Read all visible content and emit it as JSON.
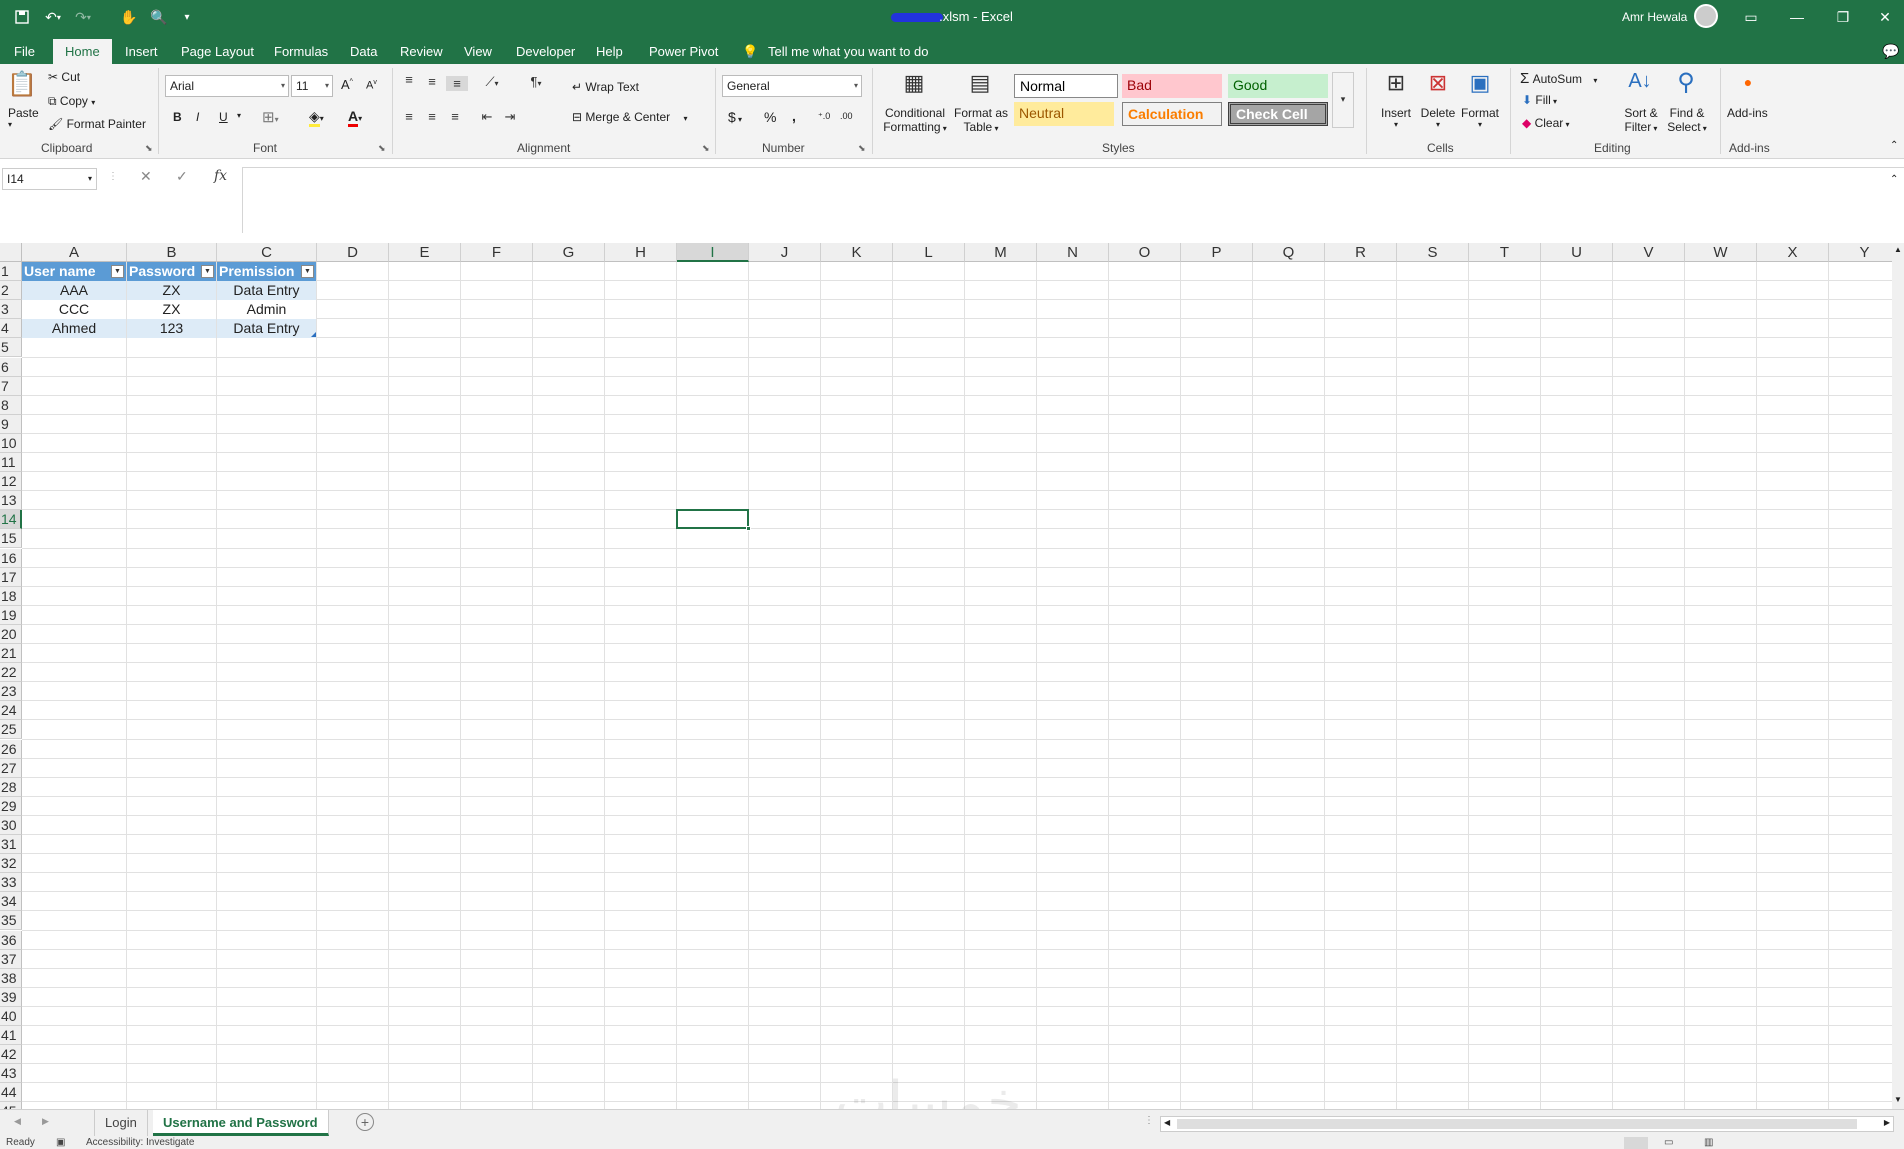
{
  "titlebar": {
    "file_suffix": ".xlsm",
    "separator": " - ",
    "app_name": "Excel",
    "user_name": "Amr Hewala"
  },
  "ribbon_tabs": [
    "File",
    "Home",
    "Insert",
    "Page Layout",
    "Formulas",
    "Data",
    "Review",
    "View",
    "Developer",
    "Help",
    "Power Pivot"
  ],
  "search": {
    "placeholder": "Tell me what you want to do"
  },
  "clipboard": {
    "paste": "Paste",
    "cut": "Cut",
    "copy": "Copy",
    "format_painter": "Format Painter",
    "label": "Clipboard"
  },
  "font": {
    "name": "Arial",
    "size": "11",
    "bold": "B",
    "italic": "I",
    "underline": "U",
    "label": "Font"
  },
  "alignment": {
    "wrap_text": "Wrap Text",
    "merge_center": "Merge & Center",
    "label": "Alignment"
  },
  "number": {
    "format": "General",
    "currency": "$",
    "percent": "%",
    "comma": ",",
    "label": "Number"
  },
  "styles": {
    "conditional_1": "Conditional",
    "conditional_2": "Formatting",
    "format_table_1": "Format as",
    "format_table_2": "Table",
    "normal": "Normal",
    "bad": "Bad",
    "good": "Good",
    "neutral": "Neutral",
    "calculation": "Calculation",
    "check_cell": "Check Cell",
    "label": "Styles"
  },
  "cells": {
    "insert": "Insert",
    "delete": "Delete",
    "format": "Format",
    "label": "Cells"
  },
  "editing": {
    "autosum": "AutoSum",
    "fill": "Fill",
    "clear": "Clear",
    "sort_1": "Sort &",
    "sort_2": "Filter",
    "find_1": "Find &",
    "find_2": "Select",
    "label": "Editing"
  },
  "addins": {
    "addins": "Add-ins",
    "label": "Add-ins"
  },
  "formula_bar": {
    "name_box": "I14",
    "fx": "fx",
    "value": ""
  },
  "columns": [
    "A",
    "B",
    "C",
    "D",
    "E",
    "F",
    "G",
    "H",
    "I",
    "J",
    "K",
    "L",
    "M",
    "N",
    "O",
    "P",
    "Q",
    "R",
    "S",
    "T",
    "U",
    "V",
    "W",
    "X",
    "Y"
  ],
  "selected_column": "I",
  "selected_row": 14,
  "table": {
    "headers": [
      "User name",
      "Password",
      "Premission"
    ],
    "rows": [
      [
        "AAA",
        "ZX",
        "Data Entry"
      ],
      [
        "CCC",
        "ZX",
        "Admin"
      ],
      [
        "Ahmed",
        "123",
        "Data Entry"
      ]
    ]
  },
  "sheets": [
    "Login",
    "Username and Password"
  ],
  "active_sheet": "Username and Password",
  "status": {
    "ready": "Ready",
    "accessibility": "Accessibility: Investigate"
  },
  "watermark": "خمسات",
  "colors": {
    "accent": "#217346",
    "table_header": "#5b9bd5",
    "table_band": "#ddebf7"
  }
}
